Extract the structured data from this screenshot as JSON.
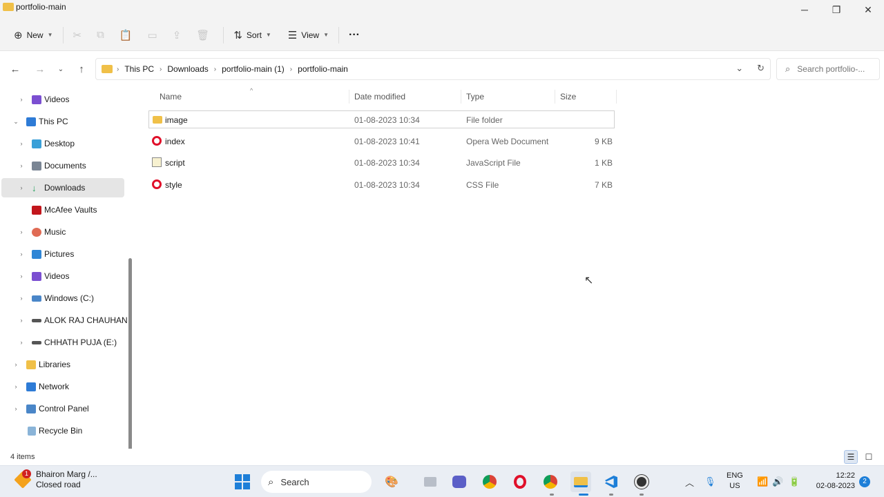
{
  "window": {
    "title": "portfolio-main",
    "controls": {
      "minimize": "─",
      "restore": "❐",
      "close": "✕"
    }
  },
  "commandbar": {
    "new_label": "New",
    "sort_label": "Sort",
    "view_label": "View",
    "more_label": "···",
    "icons": {
      "new": "⊕",
      "cut": "✂",
      "copy": "⧉",
      "paste": "📋",
      "rename": "▭",
      "share": "⇪",
      "delete": "🗑",
      "sort": "⇅",
      "view": "☰"
    }
  },
  "address": {
    "crumbs": [
      "This PC",
      "Downloads",
      "portfolio-main (1)",
      "portfolio-main"
    ],
    "search_placeholder": "Search portfolio-..."
  },
  "navpane": {
    "items": [
      {
        "label": "Videos",
        "color": "#7b4fd1"
      },
      {
        "label": "This PC",
        "color": "#2e7bd6"
      },
      {
        "label": "Desktop",
        "color": "#3aa0d8"
      },
      {
        "label": "Documents",
        "color": "#7a8594"
      },
      {
        "label": "Downloads",
        "color": "#1e9f5a"
      },
      {
        "label": "McAfee Vaults",
        "color": "#c2161c"
      },
      {
        "label": "Music",
        "color": "#e06b54"
      },
      {
        "label": "Pictures",
        "color": "#2f86d6"
      },
      {
        "label": "Videos",
        "color": "#7b4fd1"
      },
      {
        "label": "Windows (C:)",
        "color": "#4a86c8"
      },
      {
        "label": "ALOK RAJ CHAUHAN",
        "color": "#555555"
      },
      {
        "label": "CHHATH PUJA  (E:)",
        "color": "#555555"
      },
      {
        "label": "Libraries",
        "color": "#f0c048"
      },
      {
        "label": "Network",
        "color": "#2e7bd6"
      },
      {
        "label": "Control Panel",
        "color": "#4a86c8"
      },
      {
        "label": "Recycle Bin",
        "color": "#8ab4d8"
      }
    ]
  },
  "list": {
    "columns": [
      "Name",
      "Date modified",
      "Type",
      "Size"
    ],
    "rows": [
      {
        "name": "image",
        "date": "01-08-2023 10:34",
        "type": "File folder",
        "size": ""
      },
      {
        "name": "index",
        "date": "01-08-2023 10:41",
        "type": "Opera Web Document",
        "size": "9 KB"
      },
      {
        "name": "script",
        "date": "01-08-2023 10:34",
        "type": "JavaScript File",
        "size": "1 KB"
      },
      {
        "name": "style",
        "date": "01-08-2023 10:34",
        "type": "CSS File",
        "size": "7 KB"
      }
    ]
  },
  "status": {
    "items_count": "4 items"
  },
  "taskbar": {
    "weather_badge": "1",
    "weather_line1": "Bhairon Marg /...",
    "weather_line2": "Closed road",
    "search_label": "Search",
    "lang_line1": "ENG",
    "lang_line2": "US",
    "time": "12:22",
    "date": "02-08-2023",
    "notifications": "2"
  }
}
